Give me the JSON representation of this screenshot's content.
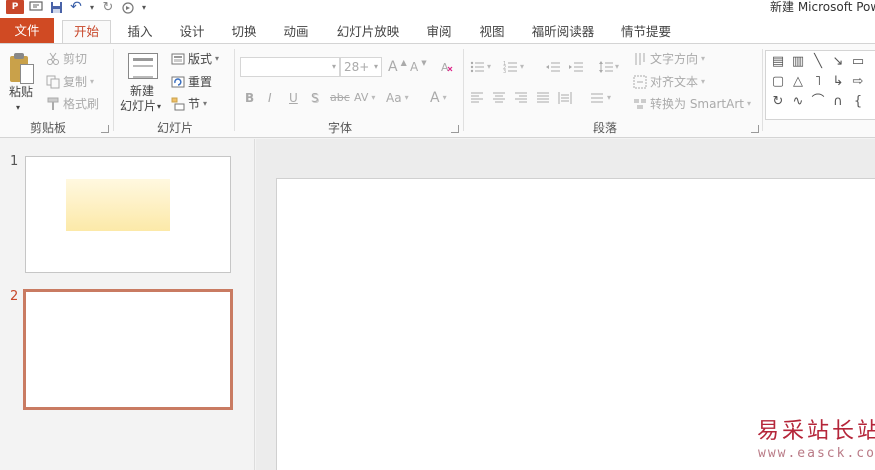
{
  "window": {
    "title": "新建 Microsoft Pow"
  },
  "qat": {
    "logo": "P",
    "undo": "↶",
    "redo": "↻",
    "more": "▾"
  },
  "tabs": [
    "文件",
    "开始",
    "插入",
    "设计",
    "切换",
    "动画",
    "幻灯片放映",
    "审阅",
    "视图",
    "福昕阅读器",
    "情节提要"
  ],
  "clipboard": {
    "paste": "粘贴",
    "cut": "剪切",
    "copy": "复制",
    "format_painter": "格式刷",
    "group_label": "剪贴板"
  },
  "slides_group": {
    "new_slide_line1": "新建",
    "new_slide_line2": "幻灯片",
    "layout": "版式",
    "reset": "重置",
    "section": "节",
    "group_label": "幻灯片"
  },
  "font_group": {
    "font_name": "",
    "font_size": "28+",
    "grow": "A",
    "shrink": "A",
    "bold": "B",
    "italic": "I",
    "underline": "U",
    "shadow": "S",
    "strike": "abc",
    "spacing": "AV",
    "case": "Aa",
    "color": "A",
    "group_label": "字体"
  },
  "paragraph_group": {
    "text_direction": "文字方向",
    "align_text": "对齐文本",
    "convert_smartart": "转换为 SmartArt",
    "group_label": "段落"
  },
  "slide_pane": {
    "slides": [
      {
        "number": "1",
        "active": false
      },
      {
        "number": "2",
        "active": true
      }
    ]
  },
  "watermark": {
    "name": "易采站长站",
    "url": "www.easck.com"
  },
  "colors": {
    "accent": "#c8472a",
    "file_tab": "#d04a23",
    "selection_border": "#c97b62",
    "watermark": "#b5263a"
  }
}
